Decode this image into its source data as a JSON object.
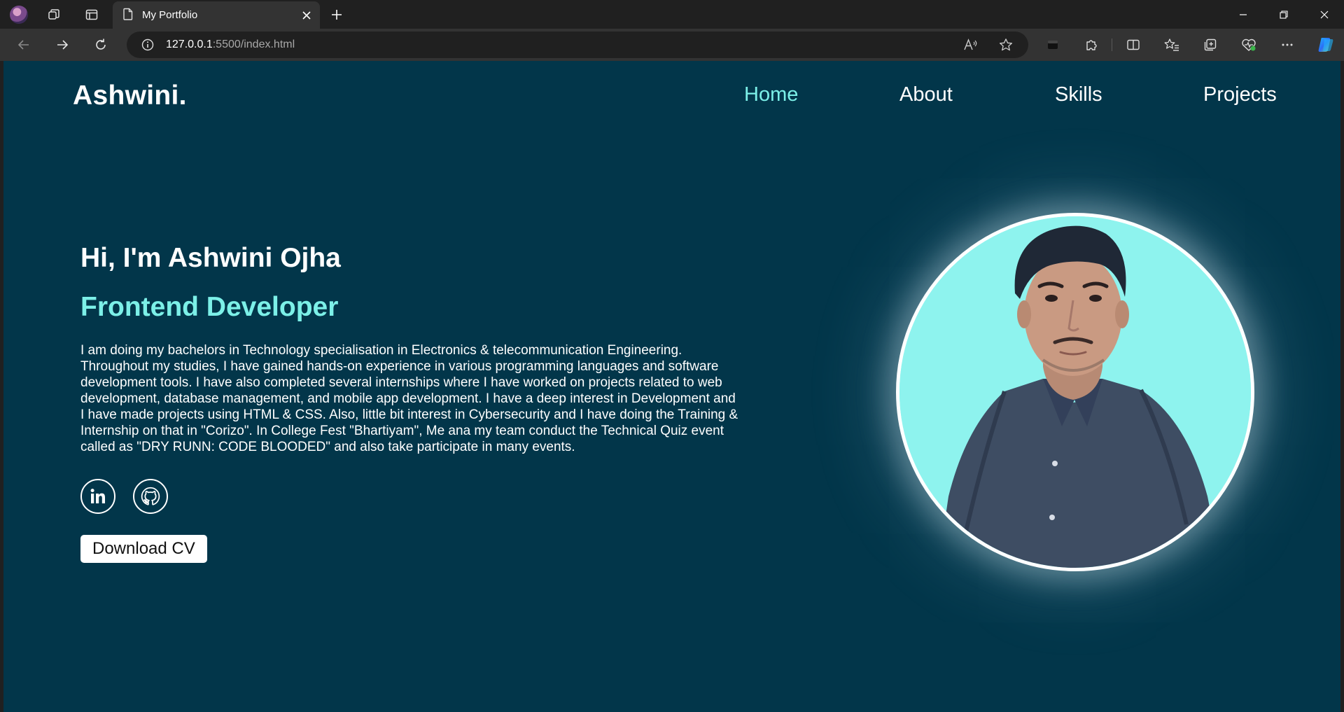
{
  "browser": {
    "tab_title": "My Portfolio",
    "url_host": "127.0.0.1",
    "url_path": ":5500/index.html"
  },
  "site": {
    "logo": "Ashwini.",
    "nav": [
      {
        "label": "Home",
        "active": true
      },
      {
        "label": "About",
        "active": false
      },
      {
        "label": "Skills",
        "active": false
      },
      {
        "label": "Projects",
        "active": false
      }
    ],
    "accent_color": "#7cf0e8",
    "background_color": "#02364a"
  },
  "hero": {
    "greeting": "Hi, I'm Ashwini Ojha",
    "role": "Frontend Developer",
    "bio": "I am doing my bachelors in Technology specialisation in Electronics & telecommunication Engineering. Throughout my studies, I have gained hands-on experience in various programming languages and software development tools. I have also completed several internships where I have worked on projects related to web development, database management, and mobile app development. I have a deep interest in Development and I have made projects using HTML & CSS. Also, little bit interest in Cybersecurity and I have doing the Training & Internship on that in \"Corizo\". In College Fest \"Bhartiyam\", Me ana my team conduct the Technical Quiz event called as \"DRY RUNN: CODE BLOODED\" and also take participate in many events.",
    "socials": [
      "linkedin-icon",
      "github-icon"
    ],
    "cv_button": "Download CV"
  }
}
